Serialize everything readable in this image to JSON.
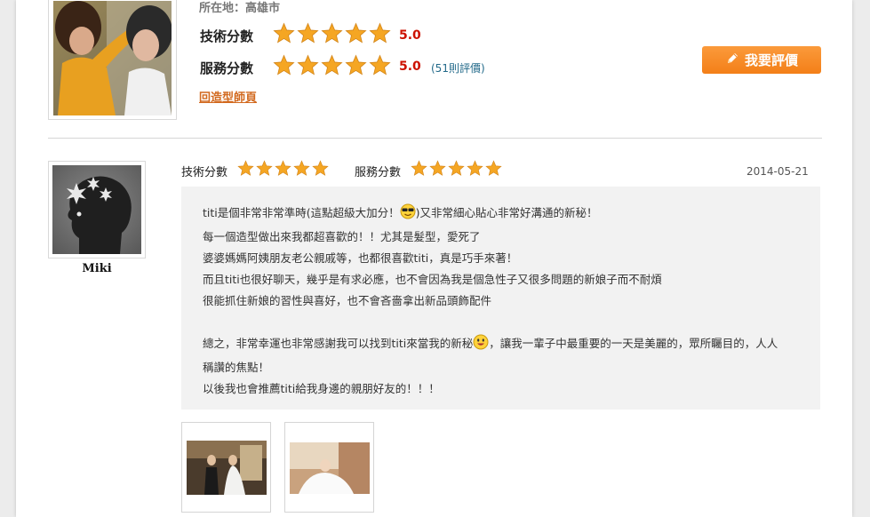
{
  "top": {
    "location": "所在地：高雄市",
    "tech_label": "技術分數",
    "tech_score": "5.0",
    "tech_rating": 5,
    "service_label": "服務分數",
    "service_score": "5.0",
    "service_rating": 5,
    "review_count": "(51則評價)",
    "back_link": "回造型師頁",
    "review_button": "我要評價",
    "review_button_icon": "pencil-icon"
  },
  "review": {
    "reviewer_name": "Miki",
    "tech_label": "技術分數",
    "tech_rating": 5,
    "service_label": "服務分數",
    "service_rating": 5,
    "date": "2014-05-21",
    "lines": {
      "l1a": "titi是個非常非常準時(這點超級大加分！",
      "l1b": ")又非常細心貼心非常好溝通的新秘！",
      "l2": "每一個造型做出來我都超喜歡的！！尤其是髮型，愛死了",
      "l3": "婆婆媽媽阿姨朋友老公親戚等，也都很喜歡titi，真是巧手來著！",
      "l4": "而且titi也很好聊天，幾乎是有求必應，也不會因為我是個急性子又很多問題的新娘子而不耐煩",
      "l5": "很能抓住新娘的習性與喜好，也不會吝嗇拿出新品頭飾配件",
      "l6a": "總之，非常幸運也非常感謝我可以找到titi來當我的新秘",
      "l6b": "，讓我一輩子中最重要的一天是美麗的，眾所矚目的，人人",
      "l7": "稱讚的焦點！",
      "l8": "以後我也會推薦titi給我身邊的親朋好友的！！！"
    },
    "emoji_1": "sunglasses-emoji",
    "emoji_2": "smile-emoji"
  },
  "colors": {
    "accent_orange": "#f5881f",
    "score_red": "#cc1100",
    "star_gold": "#f5a623"
  }
}
